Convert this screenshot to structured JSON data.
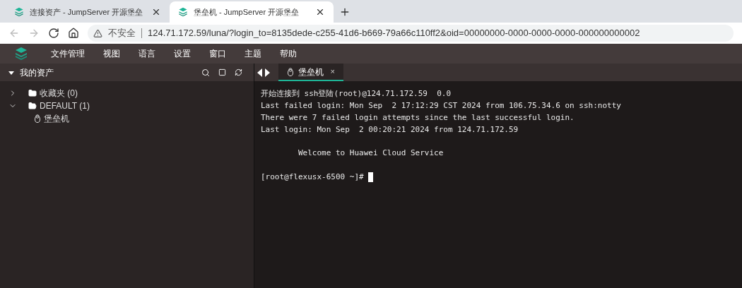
{
  "browser": {
    "tabs": [
      {
        "title": "连接资产 - JumpServer 开源堡垒",
        "selected": false
      },
      {
        "title": "堡垒机 - JumpServer 开源堡垒",
        "selected": true
      }
    ],
    "security": "不安全",
    "url": "124.71.172.59/luna/?login_to=8135dede-c255-41d6-b669-79a66c110ff2&oid=00000000-0000-0000-0000-000000000002"
  },
  "menu": [
    "文件管理",
    "视图",
    "语言",
    "设置",
    "窗口",
    "主题",
    "帮助"
  ],
  "sidebar": {
    "title": "我的资产",
    "expanded": true,
    "tree": [
      {
        "kind": "folder",
        "label": "收藏夹 (0)",
        "expanded": false
      },
      {
        "kind": "folder",
        "label": "DEFAULT (1)",
        "expanded": true,
        "children": [
          {
            "kind": "asset",
            "label": "堡垒机"
          }
        ]
      }
    ]
  },
  "session_tabs": [
    {
      "label": "堡垒机",
      "selected": true,
      "close": "×"
    }
  ],
  "terminal": [
    {
      "kind": "output",
      "text": "开始连接到 ssh登陆(root)@124.71.172.59  0.0"
    },
    {
      "kind": "output",
      "text": "Last failed login: Mon Sep  2 17:12:29 CST 2024 from 106.75.34.6 on ssh:notty"
    },
    {
      "kind": "output",
      "text": "There were 7 failed login attempts since the last successful login."
    },
    {
      "kind": "output",
      "text": "Last login: Mon Sep  2 00:20:21 2024 from 124.71.172.59"
    },
    {
      "kind": "banner",
      "text": "        Welcome to Huawei Cloud Service"
    },
    {
      "kind": "prompt",
      "text": "[root@flexusx-6500 ~]#"
    }
  ]
}
